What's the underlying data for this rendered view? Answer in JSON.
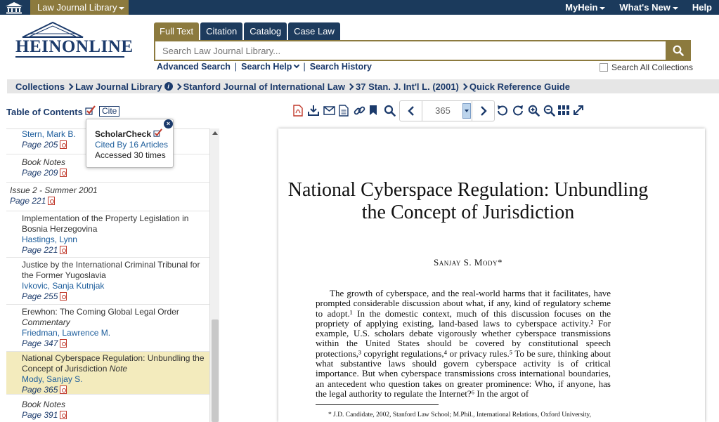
{
  "topbar": {
    "library_tab": "Law Journal Library",
    "links": [
      "MyHein",
      "What's New",
      "Help"
    ]
  },
  "logo": {
    "text": "HEINONLINE"
  },
  "search": {
    "tabs": [
      "Full Text",
      "Citation",
      "Catalog",
      "Case Law"
    ],
    "active_tab": "Full Text",
    "placeholder": "Search Law Journal Library...",
    "links": [
      "Advanced Search",
      "Search Help",
      "Search History"
    ],
    "search_all_label": "Search All Collections"
  },
  "breadcrumb": [
    "Collections",
    "Law Journal Library",
    "Stanford Journal of International Law",
    "37 Stan. J. Int'l L. (2001)",
    "Quick Reference Guide"
  ],
  "toc": {
    "title": "Table of Contents",
    "cite_label": "Cite",
    "entries": [
      {
        "title": "",
        "author": "Stern, Mark B.",
        "page": "Page 205"
      },
      {
        "title": "Book Notes",
        "page": "Page 209"
      },
      {
        "issue": "Issue 2 - Summer 2001",
        "page": "Page 221"
      },
      {
        "title": "Implementation of the Property Legislation in Bosnia Herzegovina",
        "author": "Hastings, Lynn",
        "page": "Page 221"
      },
      {
        "title": "Justice by the International Criminal Tribunal for the Former Yugoslavia",
        "author": "Ivkovic, Sanja Kutnjak",
        "page": "Page 255"
      },
      {
        "title": "Erewhon: The Coming Global Legal Order",
        "subtitle": "Commentary",
        "author": "Friedman, Lawrence M.",
        "page": "Page 347"
      },
      {
        "title": "National Cyberspace Regulation: Unbundling the Concept of Jurisdiction",
        "subtitle": "Note",
        "author": "Mody, Sanjay S.",
        "page": "Page 365"
      },
      {
        "title": "Book Notes",
        "page": "Page 391"
      }
    ]
  },
  "tooltip": {
    "title": "ScholarCheck",
    "cited_by": "Cited By 16 Articles",
    "accessed": "Accessed 30 times"
  },
  "viewer": {
    "page_number": "365",
    "title": "National Cyberspace Regulation: Unbundling the Concept of Jurisdiction",
    "author": "Sanjay S. Mody*",
    "body": "The growth of cyberspace, and the real-world harms that it facilitates, have prompted considerable discussion about what, if any, kind of regulatory scheme to adopt.¹ In the domestic context, much of this discussion focuses on the propriety of applying existing, land-based laws to cyberspace activity.² For example, U.S. scholars debate vigorously whether cyberspace transmissions within the United States should be covered by constitutional speech protections,³ copyright regulations,⁴ or privacy rules.⁵ To be sure, thinking about what substantive laws should govern cyberspace activity is of critical importance. But when cyberspace transmissions cross international boundaries, an antecedent who question takes on greater prominence: Who, if anyone, has the legal authority to regulate the Internet?⁶ In the argot of",
    "footnote": "* J.D. Candidate, 2002, Stanford Law School; M.Phil., International Relations, Oxford University,"
  }
}
